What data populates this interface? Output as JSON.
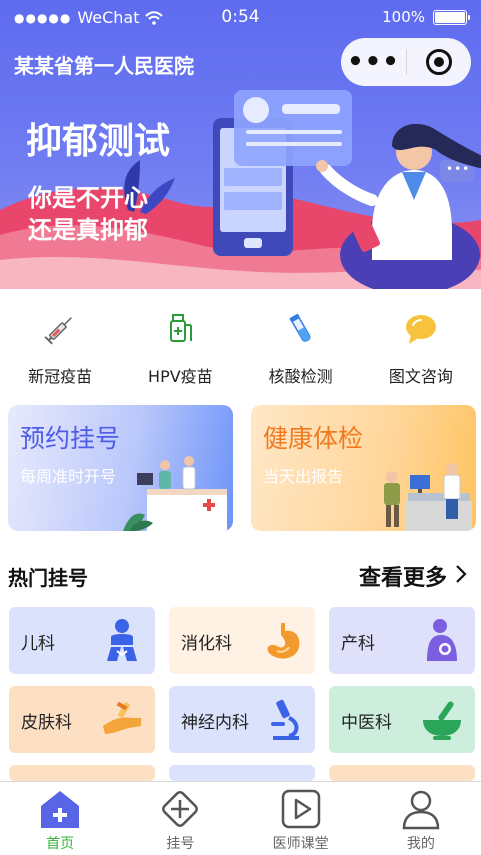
{
  "status_bar": {
    "carrier": "WeChat",
    "time": "0:54",
    "battery": "100%"
  },
  "header": {
    "hospital_name": "某某省第一人民医院",
    "capsule_more": "•••"
  },
  "banner": {
    "title": "抑郁测试",
    "line1": "你是不开心",
    "line2": "还是真抑郁",
    "more_dots": "•••"
  },
  "quick_entries": [
    {
      "label": "新冠疫苗",
      "icon": "syringe-icon"
    },
    {
      "label": "HPV疫苗",
      "icon": "vaccine-bottle-icon"
    },
    {
      "label": "核酸检测",
      "icon": "test-tube-icon"
    },
    {
      "label": "图文咨询",
      "icon": "chat-bubble-icon"
    }
  ],
  "cards": {
    "register": {
      "title": "预约挂号",
      "subtitle": "每周准时开号"
    },
    "checkup": {
      "title": "健康体检",
      "subtitle": "当天出报告"
    }
  },
  "hot": {
    "title": "热门挂号",
    "more": "查看更多",
    "departments": [
      {
        "label": "儿科",
        "icon": "child-icon"
      },
      {
        "label": "消化科",
        "icon": "stomach-icon"
      },
      {
        "label": "产科",
        "icon": "mother-baby-icon"
      },
      {
        "label": "皮肤科",
        "icon": "hand-skin-icon"
      },
      {
        "label": "神经内科",
        "icon": "microscope-icon"
      },
      {
        "label": "中医科",
        "icon": "mortar-pestle-icon"
      }
    ]
  },
  "tabbar": [
    {
      "label": "首页",
      "icon": "home-icon",
      "active": true
    },
    {
      "label": "挂号",
      "icon": "plus-diamond-icon",
      "active": false
    },
    {
      "label": "医师课堂",
      "icon": "video-play-icon",
      "active": false
    },
    {
      "label": "我的",
      "icon": "user-icon",
      "active": false
    }
  ],
  "colors": {
    "accent_green": "#36b437",
    "banner_blue": "#5e6bef",
    "register_title": "#4f5ce6",
    "checkup_title": "#ef7a1f"
  }
}
